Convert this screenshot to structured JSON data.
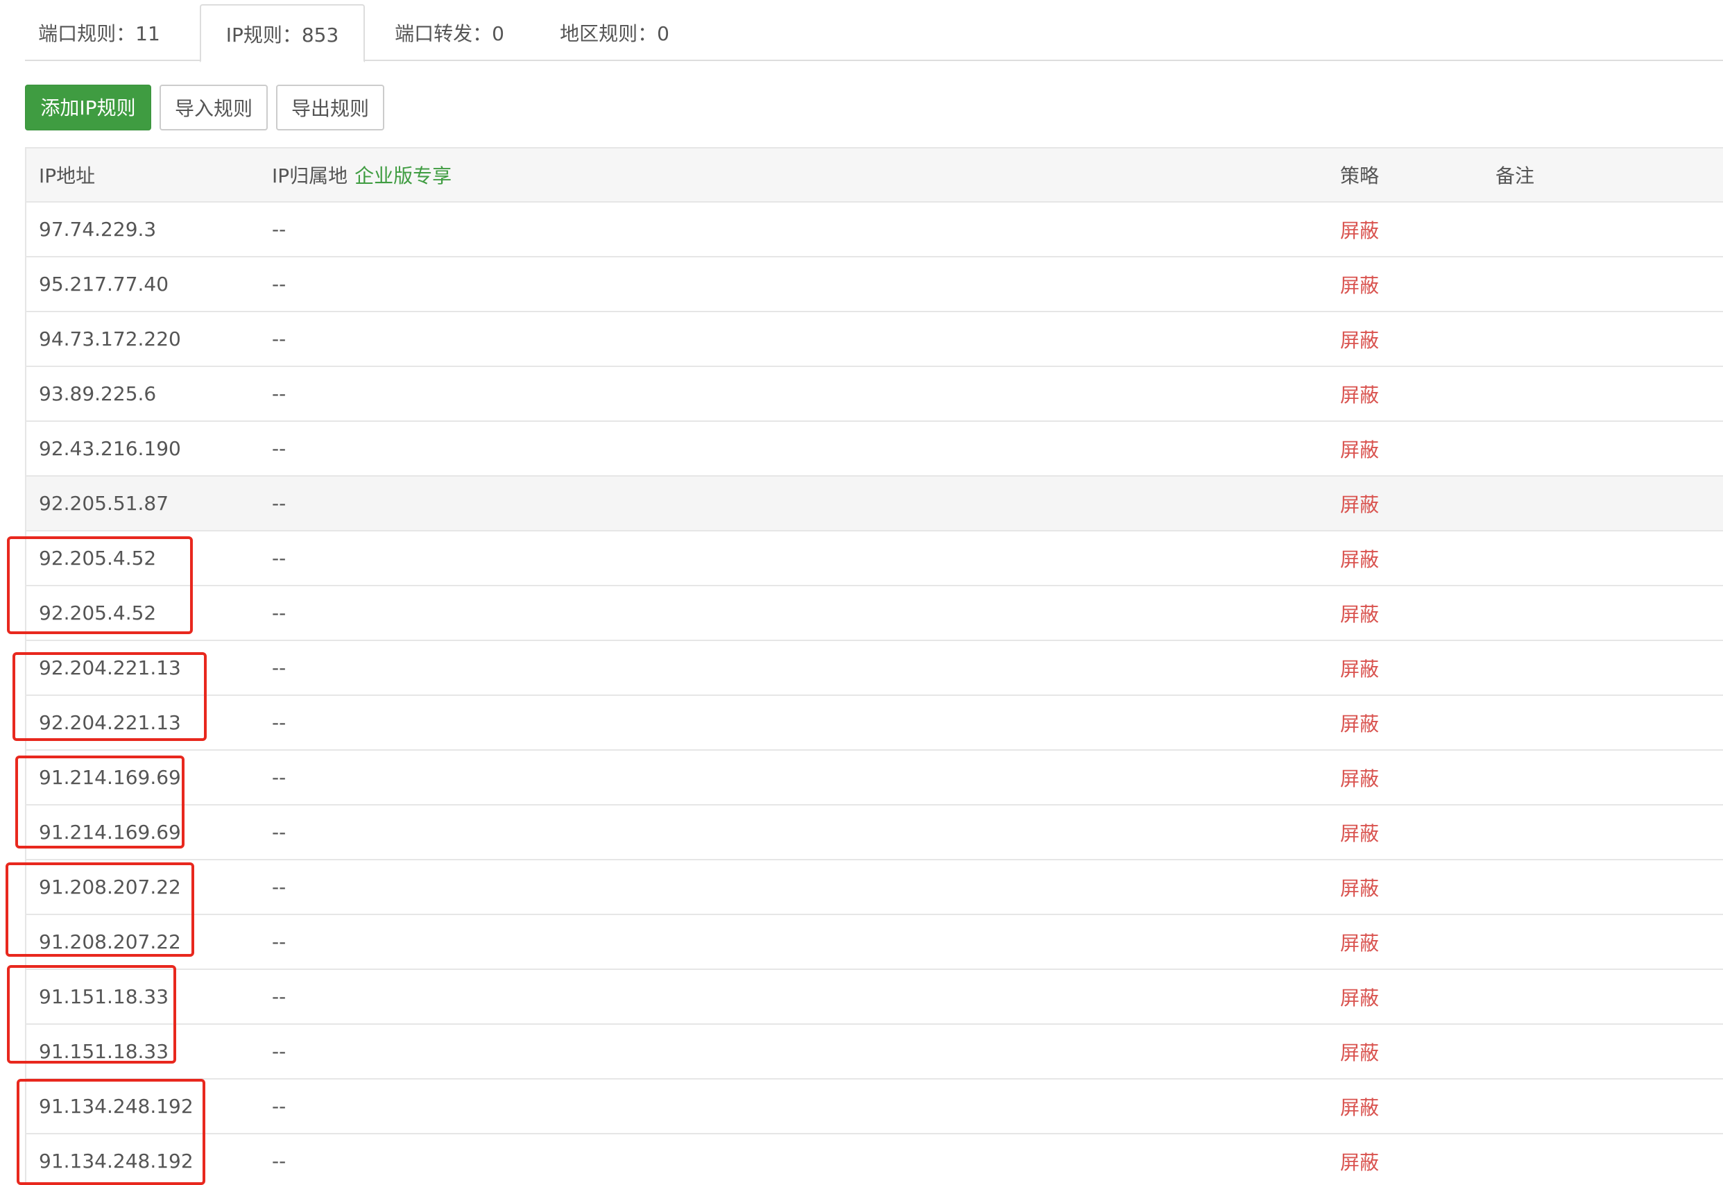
{
  "tabs": [
    {
      "label": "端口规则：11"
    },
    {
      "label": "IP规则：853"
    },
    {
      "label": "端口转发：0"
    },
    {
      "label": "地区规则：0"
    }
  ],
  "toolbar": {
    "add_label": "添加IP规则",
    "import_label": "导入规则",
    "export_label": "导出规则"
  },
  "table": {
    "headers": {
      "ip": "IP地址",
      "location": "IP归属地",
      "location_tag": "企业版专享",
      "policy": "策略",
      "note": "备注"
    },
    "rows": [
      {
        "ip": "97.74.229.3",
        "location": "--",
        "policy": "屏蔽",
        "note": ""
      },
      {
        "ip": "95.217.77.40",
        "location": "--",
        "policy": "屏蔽",
        "note": ""
      },
      {
        "ip": "94.73.172.220",
        "location": "--",
        "policy": "屏蔽",
        "note": ""
      },
      {
        "ip": "93.89.225.6",
        "location": "--",
        "policy": "屏蔽",
        "note": ""
      },
      {
        "ip": "92.43.216.190",
        "location": "--",
        "policy": "屏蔽",
        "note": ""
      },
      {
        "ip": "92.205.51.87",
        "location": "--",
        "policy": "屏蔽",
        "note": ""
      },
      {
        "ip": "92.205.4.52",
        "location": "--",
        "policy": "屏蔽",
        "note": ""
      },
      {
        "ip": "92.205.4.52",
        "location": "--",
        "policy": "屏蔽",
        "note": ""
      },
      {
        "ip": "92.204.221.13",
        "location": "--",
        "policy": "屏蔽",
        "note": ""
      },
      {
        "ip": "92.204.221.13",
        "location": "--",
        "policy": "屏蔽",
        "note": ""
      },
      {
        "ip": "91.214.169.69",
        "location": "--",
        "policy": "屏蔽",
        "note": ""
      },
      {
        "ip": "91.214.169.69",
        "location": "--",
        "policy": "屏蔽",
        "note": ""
      },
      {
        "ip": "91.208.207.22",
        "location": "--",
        "policy": "屏蔽",
        "note": ""
      },
      {
        "ip": "91.208.207.22",
        "location": "--",
        "policy": "屏蔽",
        "note": ""
      },
      {
        "ip": "91.151.18.33",
        "location": "--",
        "policy": "屏蔽",
        "note": ""
      },
      {
        "ip": "91.151.18.33",
        "location": "--",
        "policy": "屏蔽",
        "note": ""
      },
      {
        "ip": "91.134.248.192",
        "location": "--",
        "policy": "屏蔽",
        "note": ""
      },
      {
        "ip": "91.134.248.192",
        "location": "--",
        "policy": "屏蔽",
        "note": ""
      }
    ]
  },
  "colors": {
    "primary_green": "#3f9c41",
    "policy_red": "#d9534f",
    "highlight_red": "#e8281e"
  }
}
